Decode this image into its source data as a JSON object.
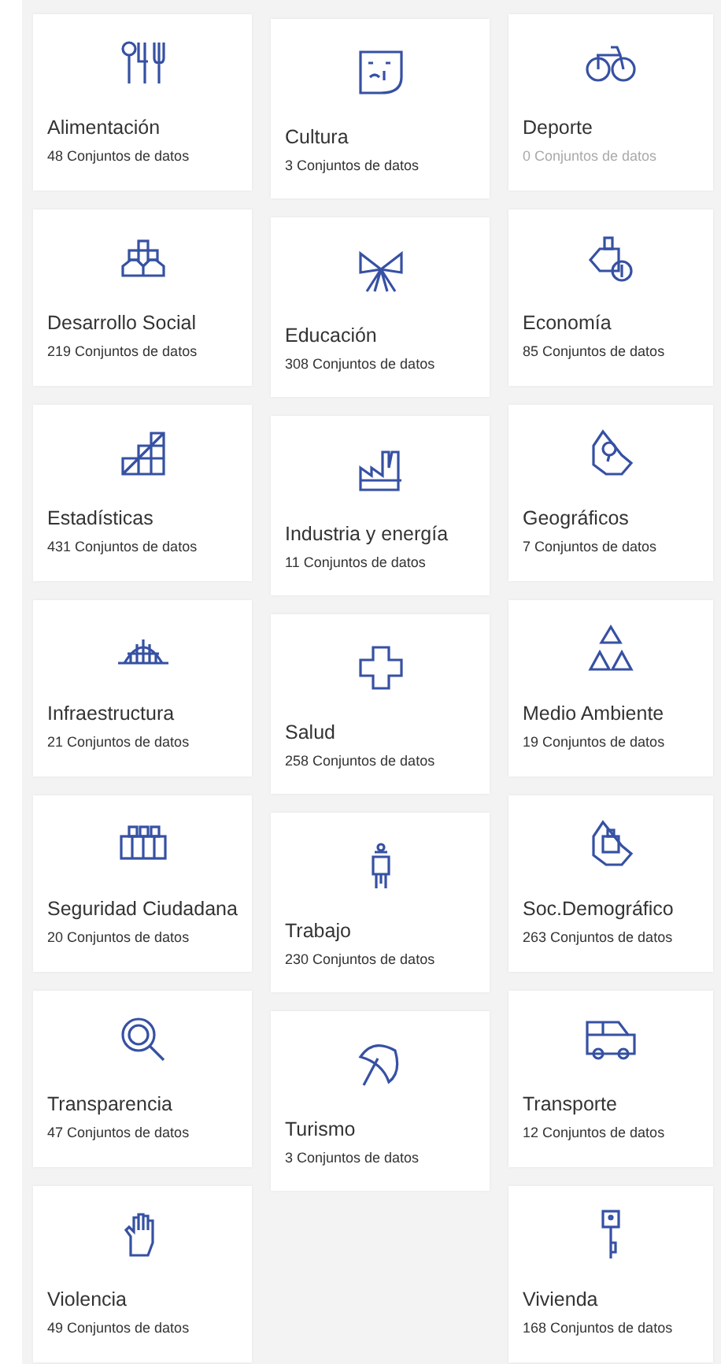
{
  "columns": [
    [
      {
        "title": "Alimentación",
        "count": "48 Conjuntos de datos",
        "empty": false
      },
      {
        "title": "Desarrollo Social",
        "count": "219 Conjuntos de datos",
        "empty": false
      },
      {
        "title": "Estadísticas",
        "count": "431 Conjuntos de datos",
        "empty": false
      },
      {
        "title": "Infraestructura",
        "count": "21 Conjuntos de datos",
        "empty": false
      },
      {
        "title": "Seguridad Ciudadana",
        "count": "20 Conjuntos de datos",
        "empty": false
      },
      {
        "title": "Transparencia",
        "count": "47 Conjuntos de datos",
        "empty": false
      },
      {
        "title": "Violencia",
        "count": "49 Conjuntos de datos",
        "empty": false
      }
    ],
    [
      {
        "title": "Cultura",
        "count": "3 Conjuntos de datos",
        "empty": false
      },
      {
        "title": "Educación",
        "count": "308 Conjuntos de datos",
        "empty": false
      },
      {
        "title": "Industria y energía",
        "count": "11 Conjuntos de datos",
        "empty": false
      },
      {
        "title": "Salud",
        "count": "258 Conjuntos de datos",
        "empty": false
      },
      {
        "title": "Trabajo",
        "count": "230 Conjuntos de datos",
        "empty": false
      },
      {
        "title": "Turismo",
        "count": "3 Conjuntos de datos",
        "empty": false
      }
    ],
    [
      {
        "title": "Deporte",
        "count": "0 Conjuntos de datos",
        "empty": true
      },
      {
        "title": "Economía",
        "count": "85 Conjuntos de datos",
        "empty": false
      },
      {
        "title": "Geográficos",
        "count": "7 Conjuntos de datos",
        "empty": false
      },
      {
        "title": "Medio Ambiente",
        "count": "19 Conjuntos de datos",
        "empty": false
      },
      {
        "title": "Soc.Demográfico",
        "count": "263 Conjuntos de datos",
        "empty": false
      },
      {
        "title": "Transporte",
        "count": "12 Conjuntos de datos",
        "empty": false
      },
      {
        "title": "Vivienda",
        "count": "168 Conjuntos de datos",
        "empty": false
      }
    ]
  ]
}
